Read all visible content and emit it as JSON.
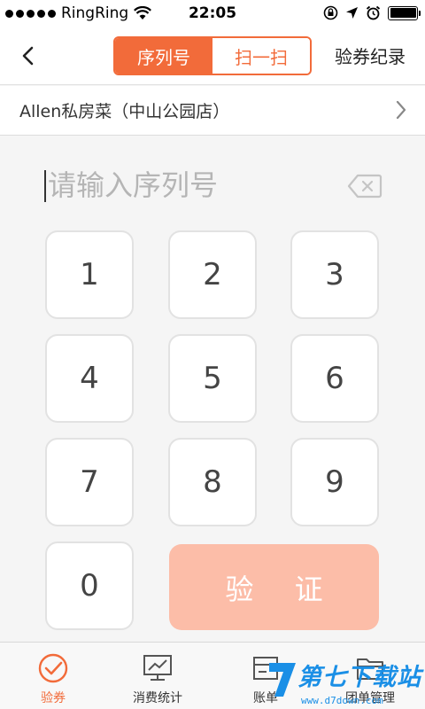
{
  "status_bar": {
    "carrier": "RingRing",
    "time": "22:05"
  },
  "nav": {
    "tabs": [
      {
        "label": "序列号",
        "active": true
      },
      {
        "label": "扫一扫",
        "active": false
      }
    ],
    "right_link": "验券纪录"
  },
  "store": {
    "name": "Allen私房菜（中山公园店）"
  },
  "serial_input": {
    "value": "",
    "placeholder": "请输入序列号"
  },
  "keypad": {
    "keys": [
      "1",
      "2",
      "3",
      "4",
      "5",
      "6",
      "7",
      "8",
      "9",
      "0"
    ],
    "verify_label": "验 证"
  },
  "tab_bar": {
    "items": [
      {
        "label": "验券",
        "icon": "check-circle-icon",
        "active": true
      },
      {
        "label": "消费统计",
        "icon": "chart-icon",
        "active": false
      },
      {
        "label": "账单",
        "icon": "bill-icon",
        "active": false
      },
      {
        "label": "团单管理",
        "icon": "folder-icon",
        "active": false
      }
    ]
  },
  "watermark": {
    "text": "第七下载站",
    "url": "www.d7down.com"
  },
  "colors": {
    "accent": "#f26b3a",
    "verify_disabled": "#fcbda8",
    "watermark": "#1a8fe6"
  }
}
